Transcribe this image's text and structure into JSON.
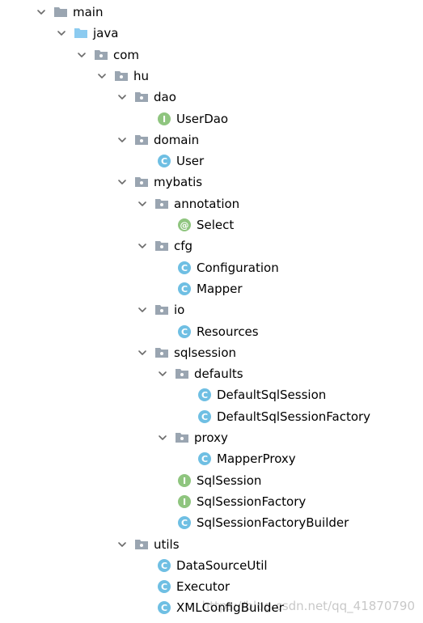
{
  "colors": {
    "folder": "#9aa5b1",
    "source_folder": "#8ccbf0",
    "arrow": "#6b6b6b",
    "class_icon": "#6fbfe3",
    "interface_icon": "#8fc57f",
    "annotation_icon": "#8fc57f"
  },
  "tree": [
    {
      "label": "main",
      "depth": 0,
      "kind": "folder",
      "expanded": true
    },
    {
      "label": "java",
      "depth": 1,
      "kind": "source-folder",
      "expanded": true
    },
    {
      "label": "com",
      "depth": 2,
      "kind": "package",
      "expanded": true
    },
    {
      "label": "hu",
      "depth": 3,
      "kind": "package",
      "expanded": true
    },
    {
      "label": "dao",
      "depth": 4,
      "kind": "package",
      "expanded": true
    },
    {
      "label": "UserDao",
      "depth": 5,
      "kind": "interface"
    },
    {
      "label": "domain",
      "depth": 4,
      "kind": "package",
      "expanded": true
    },
    {
      "label": "User",
      "depth": 5,
      "kind": "class"
    },
    {
      "label": "mybatis",
      "depth": 4,
      "kind": "package",
      "expanded": true
    },
    {
      "label": "annotation",
      "depth": 5,
      "kind": "package",
      "expanded": true
    },
    {
      "label": "Select",
      "depth": 6,
      "kind": "annotation"
    },
    {
      "label": "cfg",
      "depth": 5,
      "kind": "package",
      "expanded": true
    },
    {
      "label": "Configuration",
      "depth": 6,
      "kind": "class"
    },
    {
      "label": "Mapper",
      "depth": 6,
      "kind": "class"
    },
    {
      "label": "io",
      "depth": 5,
      "kind": "package",
      "expanded": true
    },
    {
      "label": "Resources",
      "depth": 6,
      "kind": "class"
    },
    {
      "label": "sqlsession",
      "depth": 5,
      "kind": "package",
      "expanded": true
    },
    {
      "label": "defaults",
      "depth": 6,
      "kind": "package",
      "expanded": true
    },
    {
      "label": "DefaultSqlSession",
      "depth": 7,
      "kind": "class"
    },
    {
      "label": "DefaultSqlSessionFactory",
      "depth": 7,
      "kind": "class"
    },
    {
      "label": "proxy",
      "depth": 6,
      "kind": "package",
      "expanded": true
    },
    {
      "label": "MapperProxy",
      "depth": 7,
      "kind": "class"
    },
    {
      "label": "SqlSession",
      "depth": 6,
      "kind": "interface"
    },
    {
      "label": "SqlSessionFactory",
      "depth": 6,
      "kind": "interface"
    },
    {
      "label": "SqlSessionFactoryBuilder",
      "depth": 6,
      "kind": "class"
    },
    {
      "label": "utils",
      "depth": 4,
      "kind": "package",
      "expanded": true
    },
    {
      "label": "DataSourceUtil",
      "depth": 5,
      "kind": "class"
    },
    {
      "label": "Executor",
      "depth": 5,
      "kind": "class"
    },
    {
      "label": "XMLConfigBuilder",
      "depth": 5,
      "kind": "class"
    }
  ],
  "watermark": "https://blog.csdn.net/qq_41870790"
}
